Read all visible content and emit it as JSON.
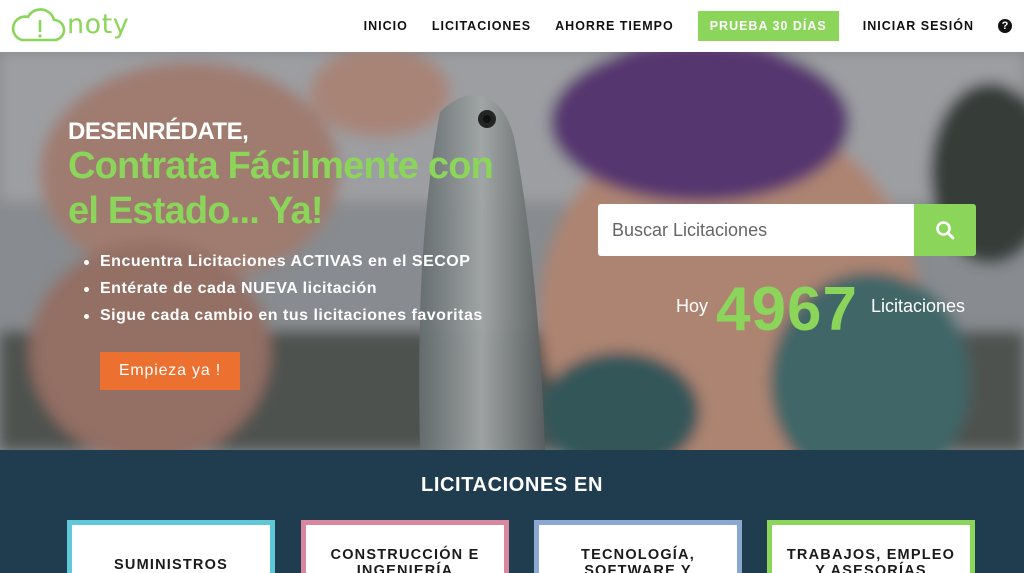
{
  "brand": {
    "name": "noty",
    "accent": "#8bd65a"
  },
  "nav": {
    "items": [
      "INICIO",
      "LICITACIONES",
      "AHORRE TIEMPO"
    ],
    "cta": "PRUEBA 30 DÍAS",
    "login": "INICIAR SESIÓN",
    "help_icon": "question-circle-icon"
  },
  "hero": {
    "tagline_top": "DESENRÉDATE,",
    "tagline_main": "Contrata Fácilmente con el Estado... Ya!",
    "bullets": [
      "Encuentra Licitaciones ACTIVAS en el SECOP",
      "Entérate de cada NUEVA licitación",
      "Sigue cada cambio en tus licitaciones favoritas"
    ],
    "start_button": "Empieza ya !",
    "start_button_color": "#ec7030",
    "search": {
      "placeholder": "Buscar Licitaciones",
      "icon": "search-icon"
    },
    "count": {
      "prefix": "Hoy",
      "value": "4967",
      "suffix": "Licitaciones"
    }
  },
  "categories": {
    "title": "LICITACIONES EN",
    "background": "#1f3d4f",
    "cards": [
      {
        "label": "SUMINISTROS",
        "color": "#5fc7d6"
      },
      {
        "label": "CONSTRUCCIÓN E INGENIERÍA",
        "color": "#d8889e"
      },
      {
        "label": "TECNOLOGÍA, SOFTWARE Y",
        "color": "#8aa8d0"
      },
      {
        "label": "TRABAJOS, EMPLEO Y ASESORÍAS",
        "color": "#8bd65a"
      }
    ]
  }
}
